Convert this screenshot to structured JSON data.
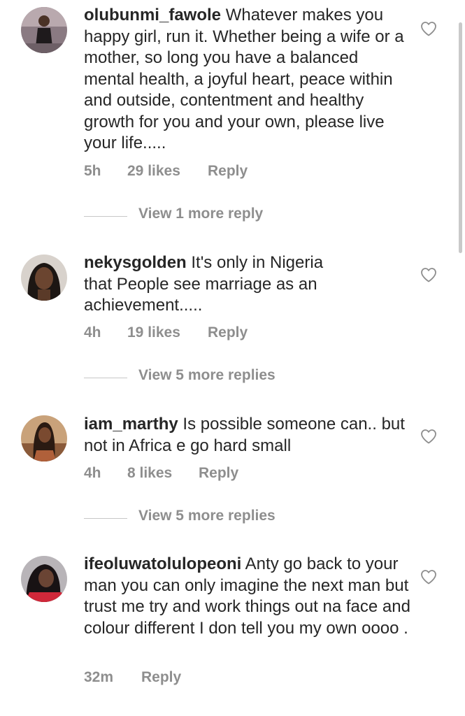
{
  "comments": [
    {
      "username": "olubunmi_fawole",
      "text": "Whatever makes you happy girl, run it.  Whether being a wife or a mother,  so long you have a balanced mental health, a joyful heart, peace within and outside,  contentment and healthy growth for you and your own, please live your life.....",
      "time": "5h",
      "likes": "29 likes",
      "reply": "Reply",
      "view_more": "View 1 more reply",
      "avatar_icon": "user-avatar"
    },
    {
      "username": "nekysgolden",
      "text": "It's only in Nigeria that People see marriage as an achievement.....",
      "time": "4h",
      "likes": "19 likes",
      "reply": "Reply",
      "view_more": "View 5 more replies",
      "avatar_icon": "user-avatar"
    },
    {
      "username": "iam_marthy",
      "text": "Is possible someone can.. but not in Africa e go hard small",
      "time": "4h",
      "likes": "8 likes",
      "reply": "Reply",
      "view_more": "View 5 more replies",
      "avatar_icon": "user-avatar"
    },
    {
      "username": "ifeoluwatolulopeoni",
      "text": "Anty go back to your man you can only imagine the next man but trust me try and work things out na face and colour different I don tell you my own oooo .",
      "time": "32m",
      "reply": "Reply",
      "avatar_icon": "user-avatar"
    }
  ],
  "icons": {
    "like": "heart-outline-icon"
  },
  "colors": {
    "text": "#262626",
    "muted": "#8e8e8e",
    "divider": "#c7c7c7",
    "background": "#ffffff"
  }
}
